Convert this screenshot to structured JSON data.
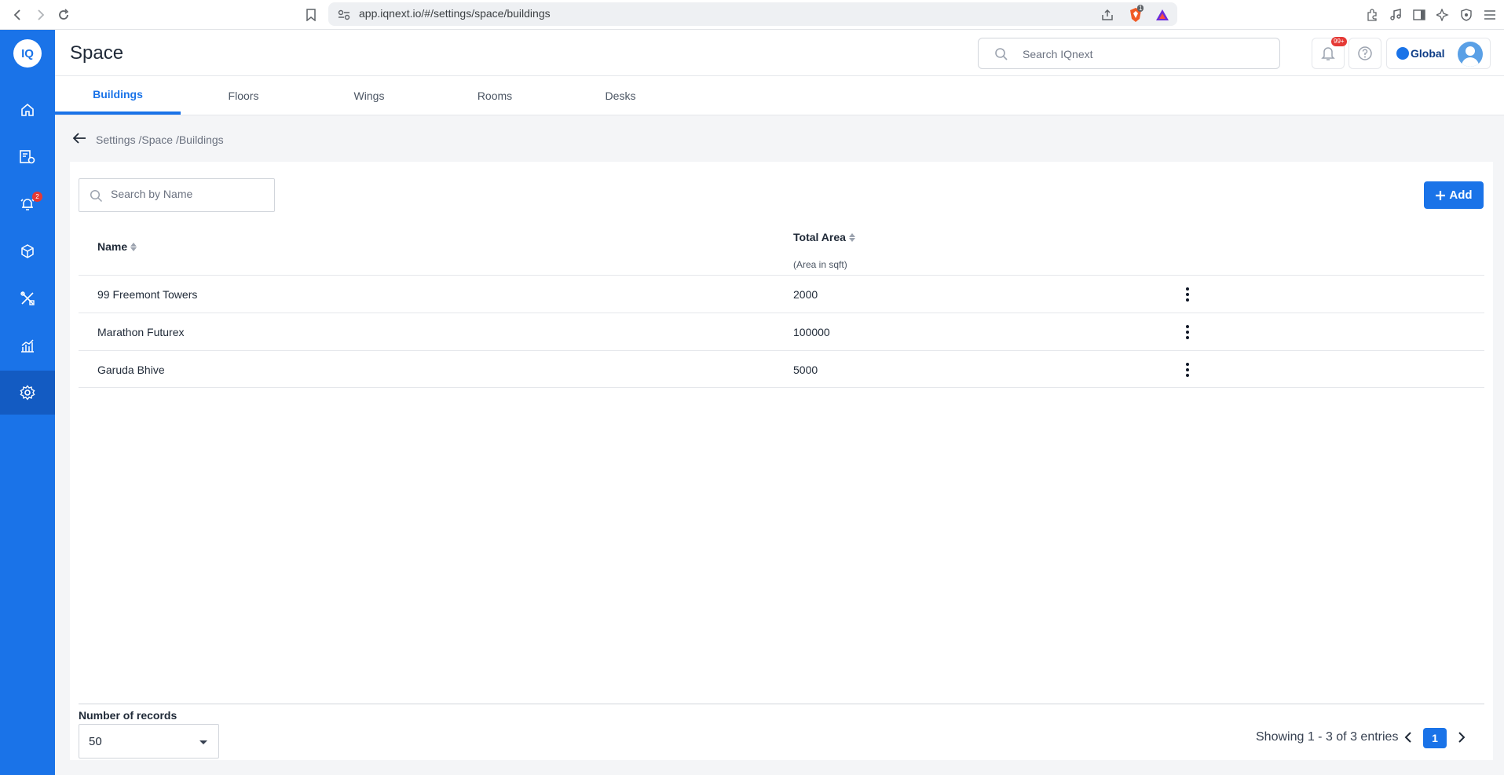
{
  "browser": {
    "url": "app.iqnext.io/#/settings/space/buildings",
    "shield_count": "1"
  },
  "sidebar": {
    "logo_text": "IQ",
    "items": [
      {
        "name": "home",
        "icon": "home-icon"
      },
      {
        "name": "assets-settings",
        "icon": "document-gear-icon"
      },
      {
        "name": "alerts",
        "icon": "alarm-bell-icon",
        "badge": "2"
      },
      {
        "name": "inventory",
        "icon": "cube-icon"
      },
      {
        "name": "maintenance",
        "icon": "tools-icon"
      },
      {
        "name": "analytics",
        "icon": "chart-icon"
      },
      {
        "name": "settings",
        "icon": "gear-icon",
        "active": true
      }
    ]
  },
  "header": {
    "title": "Space",
    "search_placeholder": "Search IQnext",
    "notification_badge": "99+",
    "brand_text": "Global"
  },
  "tabs": [
    {
      "label": "Buildings",
      "active": true
    },
    {
      "label": "Floors"
    },
    {
      "label": "Wings"
    },
    {
      "label": "Rooms"
    },
    {
      "label": "Desks"
    }
  ],
  "breadcrumb": "Settings /Space /Buildings",
  "toolbar": {
    "search_placeholder": "Search by Name",
    "add_label": "Add"
  },
  "table": {
    "columns": {
      "name": "Name",
      "total_area": "Total Area",
      "total_area_sub": "(Area in sqft)"
    },
    "rows": [
      {
        "name": "99 Freemont Towers",
        "area": "2000"
      },
      {
        "name": "Marathon Futurex",
        "area": "100000"
      },
      {
        "name": "Garuda Bhive",
        "area": "5000"
      }
    ]
  },
  "footer": {
    "records_label": "Number of records",
    "records_value": "50",
    "showing_text": "Showing 1 - 3 of 3 entries",
    "current_page": "1"
  },
  "colors": {
    "accent": "#1a73e8",
    "badge": "#e53935"
  }
}
